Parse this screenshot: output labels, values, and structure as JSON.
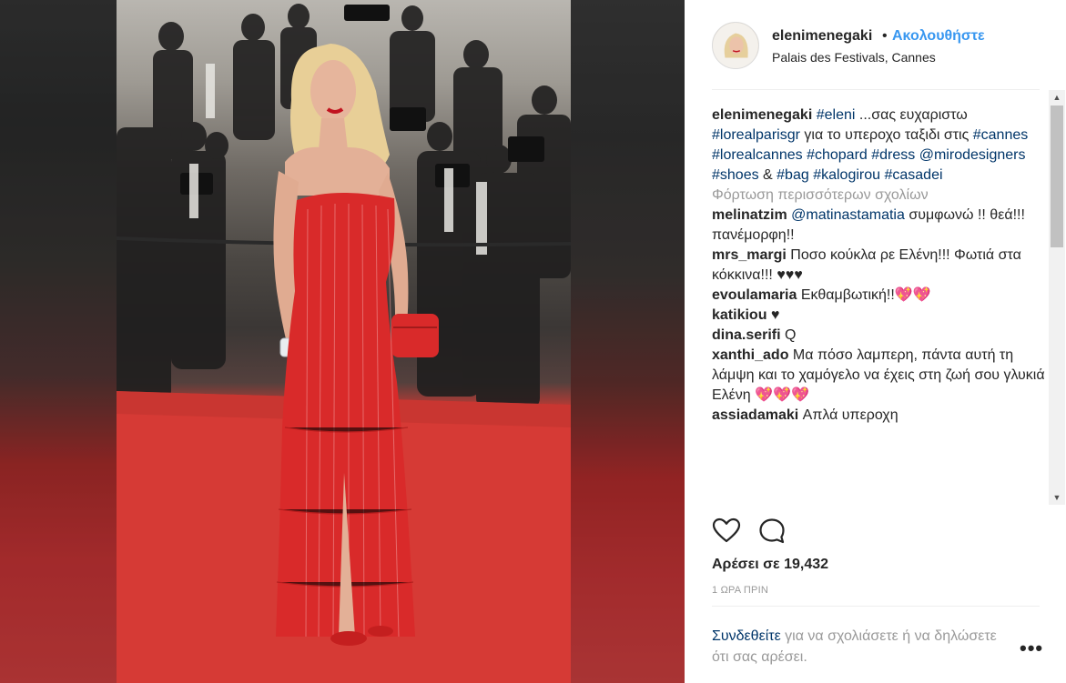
{
  "post": {
    "username": "elenimenegaki",
    "separator": "•",
    "follow_label": "Ακολουθήστε",
    "location": "Palais des Festivals, Cannes"
  },
  "caption": {
    "username": "elenimenegaki",
    "tag1": "#eleni",
    "text1": " ...σας ευχαριστω ",
    "tag2": "#lorealparisgr",
    "text2": " για το υπεροχο ταξιδι στις ",
    "tag3": "#cannes",
    "tag4": "#lorealcannes",
    "tag5": "#chopard",
    "tag6": "#dress",
    "tag7": "@mirodesigners",
    "tag8": "#shoes",
    "amp": " & ",
    "tag9": "#bag",
    "tag10": "#kalogirou",
    "tag11": "#casadei"
  },
  "load_more": "Φόρτωση περισσότερων σχολίων",
  "comments": [
    {
      "user": "melinatzim",
      "mention": "@matinastamatia",
      "text": " συμφωνώ !! θεά!!! πανέμορφη!!"
    },
    {
      "user": "mrs_margi",
      "text": "Ποσο κούκλα ρε Ελένη!!! Φωτιά στα κόκκινα!!! ♥♥♥"
    },
    {
      "user": "evoulamaria",
      "text": "Εκθαμβωτική!!💖💖"
    },
    {
      "user": "katikiou",
      "text": "♥"
    },
    {
      "user": "dina.serifi",
      "text": "Q"
    },
    {
      "user": "xanthi_ado",
      "text": "Μα πόσο λαμπερη, πάντα αυτή τη λάμψη και το χαμόγελο να έχεις στη ζωή σου γλυκιά Ελένη 💖💖💖"
    },
    {
      "user": "assiadamaki",
      "text": "Απλά υπεροχη"
    }
  ],
  "likes_text": "Αρέσει σε 19,432",
  "time_text": "1 ΩΡΑ ΠΡΙΝ",
  "login": {
    "link": "Συνδεθείτε",
    "text": " για να σχολιάσετε ή να δηλώσετε ότι σας αρέσει."
  },
  "more_label": "•••",
  "icons": {
    "like": "heart-icon",
    "comment": "comment-bubble-icon",
    "more": "more-options-icon"
  },
  "colors": {
    "link_blue": "#3897f0",
    "hashtag": "#003569",
    "muted": "#999999",
    "dress_red": "#d92a2a"
  }
}
